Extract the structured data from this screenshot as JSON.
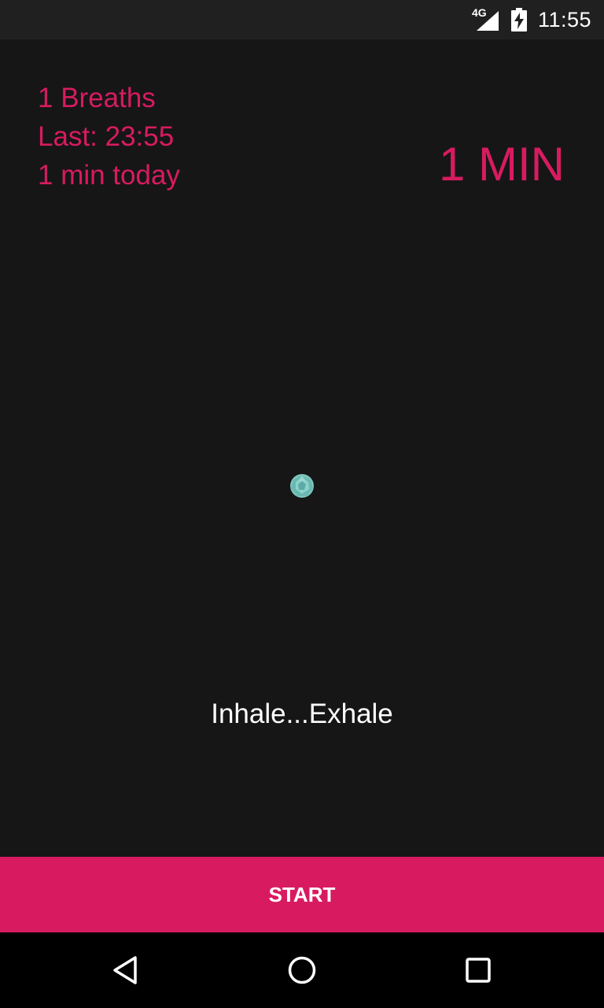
{
  "status_bar": {
    "network": "4G",
    "time": "11:55",
    "icons": [
      "signal-icon",
      "battery-charging-icon"
    ]
  },
  "stats": {
    "breaths": "1 Breaths",
    "last": "Last: 23:55",
    "today": "1 min today"
  },
  "duration": "1 MIN",
  "guide_text": "Inhale...Exhale",
  "start_label": "START",
  "nav": {
    "icons": [
      "back-icon",
      "home-icon",
      "recents-icon"
    ]
  },
  "colors": {
    "accent": "#d81b60",
    "background": "#161616",
    "orb": "#7ec8c0"
  }
}
